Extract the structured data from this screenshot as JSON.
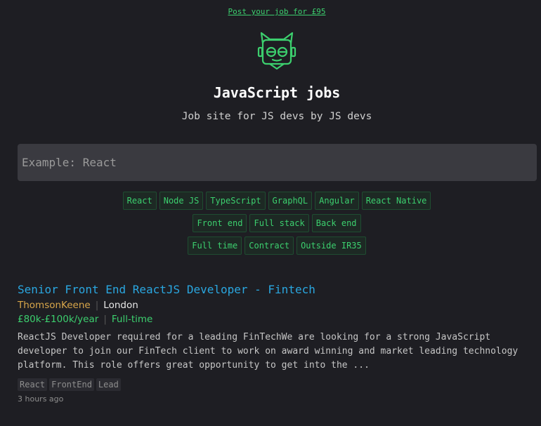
{
  "header": {
    "post_job_link": "Post your job for £95",
    "title": "JavaScript jobs",
    "tagline": "Job site for JS devs by JS devs"
  },
  "logo": {
    "icon": "robot-mascot-icon",
    "color": "#3ccf6e"
  },
  "search": {
    "placeholder": "Example: React",
    "value": ""
  },
  "filters": {
    "row1": [
      "React",
      "Node JS",
      "TypeScript",
      "GraphQL",
      "Angular",
      "React Native"
    ],
    "row2": [
      "Front end",
      "Full stack",
      "Back end"
    ],
    "row3": [
      "Full time",
      "Contract",
      "Outside IR35"
    ]
  },
  "jobs": [
    {
      "title": "Senior Front End ReactJS Developer - Fintech",
      "company": "ThomsonKeene",
      "location": "London",
      "salary": "£80k-£100k/year",
      "type": "Full-time",
      "description": "ReactJS Developer required for a leading FinTech​We are looking for a strong JavaScript developer to join our FinTech client to work on award winning and market leading technology platform. This role offers great opportunity to get into the ...",
      "tags": [
        "React",
        "FrontEnd",
        "Lead"
      ],
      "posted": "3 hours ago"
    }
  ],
  "colors": {
    "background": "#1e1e23",
    "accent_green": "#3ccf6e",
    "link_blue": "#2aa7e0",
    "company_gold": "#d8a64a"
  }
}
